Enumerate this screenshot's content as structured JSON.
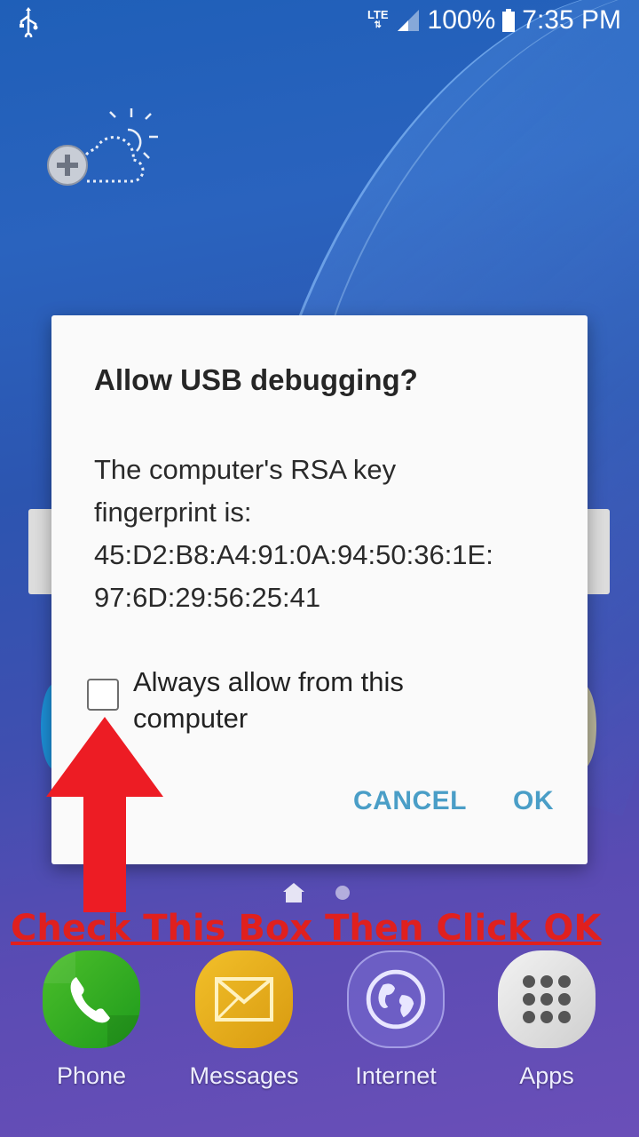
{
  "status_bar": {
    "network": "LTE",
    "battery": "100%",
    "time": "7:35 PM"
  },
  "dialog": {
    "title": "Allow USB debugging?",
    "body_lines": [
      "The computer's RSA key",
      "fingerprint is:",
      "45:D2:B8:A4:91:0A:94:50:36:1E:",
      "97:6D:29:56:25:41"
    ],
    "checkbox_label": "Always allow from this computer",
    "checkbox_checked": false,
    "cancel_label": "CANCEL",
    "ok_label": "OK"
  },
  "annotation": {
    "text": "Check This Box Then Click OK",
    "color": "#e0201e"
  },
  "dock": {
    "items": [
      {
        "label": "Phone",
        "icon": "phone-icon"
      },
      {
        "label": "Messages",
        "icon": "envelope-icon"
      },
      {
        "label": "Internet",
        "icon": "globe-icon"
      },
      {
        "label": "Apps",
        "icon": "apps-grid-icon"
      }
    ]
  },
  "colors": {
    "accent_button": "#4a9ec7",
    "dialog_bg": "#fafafa"
  }
}
